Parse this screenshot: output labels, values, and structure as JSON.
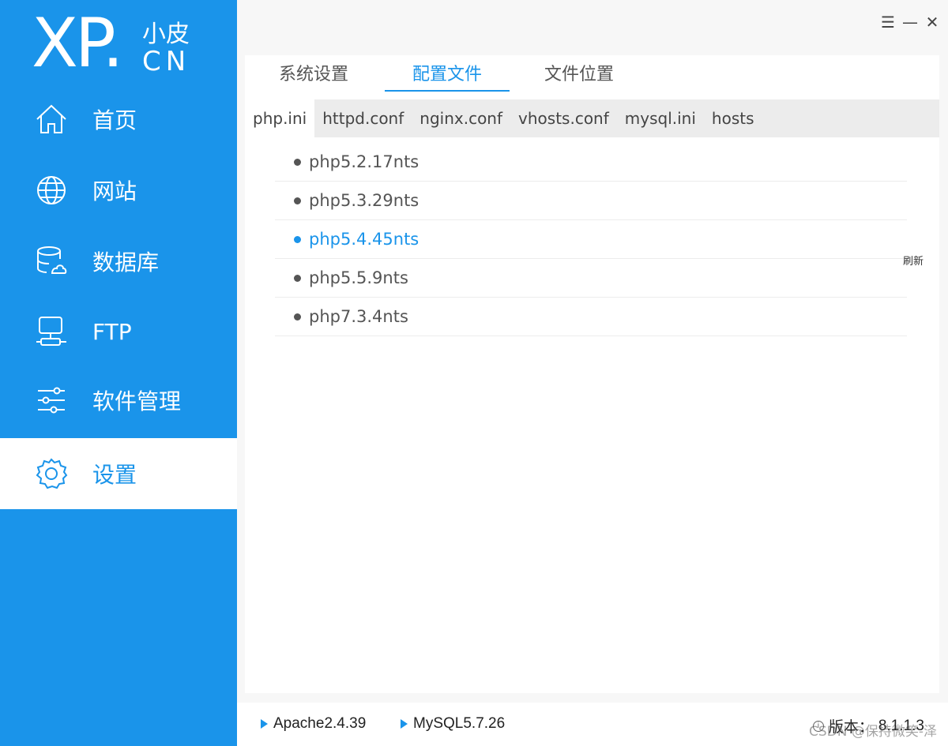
{
  "logo": {
    "main": "XP.",
    "cn_top": "小皮",
    "cn_bottom": "CN"
  },
  "nav": [
    {
      "label": "首页",
      "icon": "home-icon"
    },
    {
      "label": "网站",
      "icon": "globe-icon"
    },
    {
      "label": "数据库",
      "icon": "database-icon"
    },
    {
      "label": "FTP",
      "icon": "ftp-icon"
    },
    {
      "label": "软件管理",
      "icon": "sliders-icon"
    },
    {
      "label": "设置",
      "icon": "gear-icon",
      "active": true
    }
  ],
  "window": {
    "menu": "☰",
    "minimize": "—",
    "close": "✕"
  },
  "tabs": [
    {
      "label": "系统设置"
    },
    {
      "label": "配置文件",
      "active": true
    },
    {
      "label": "文件位置"
    }
  ],
  "subtabs": [
    "php.ini",
    "httpd.conf",
    "nginx.conf",
    "vhosts.conf",
    "mysql.ini",
    "hosts"
  ],
  "versions": [
    {
      "label": "php5.2.17nts"
    },
    {
      "label": "php5.3.29nts"
    },
    {
      "label": "php5.4.45nts",
      "selected": true
    },
    {
      "label": "php5.5.9nts"
    },
    {
      "label": "php7.3.4nts"
    }
  ],
  "refresh_label": "刷新",
  "status": {
    "apache": "Apache2.4.39",
    "mysql": "MySQL5.7.26",
    "version_label": "版本：",
    "version_value": "8.1.1.3"
  },
  "watermark": "CSDN @保持微笑-泽",
  "colors": {
    "accent": "#1a94ea"
  }
}
